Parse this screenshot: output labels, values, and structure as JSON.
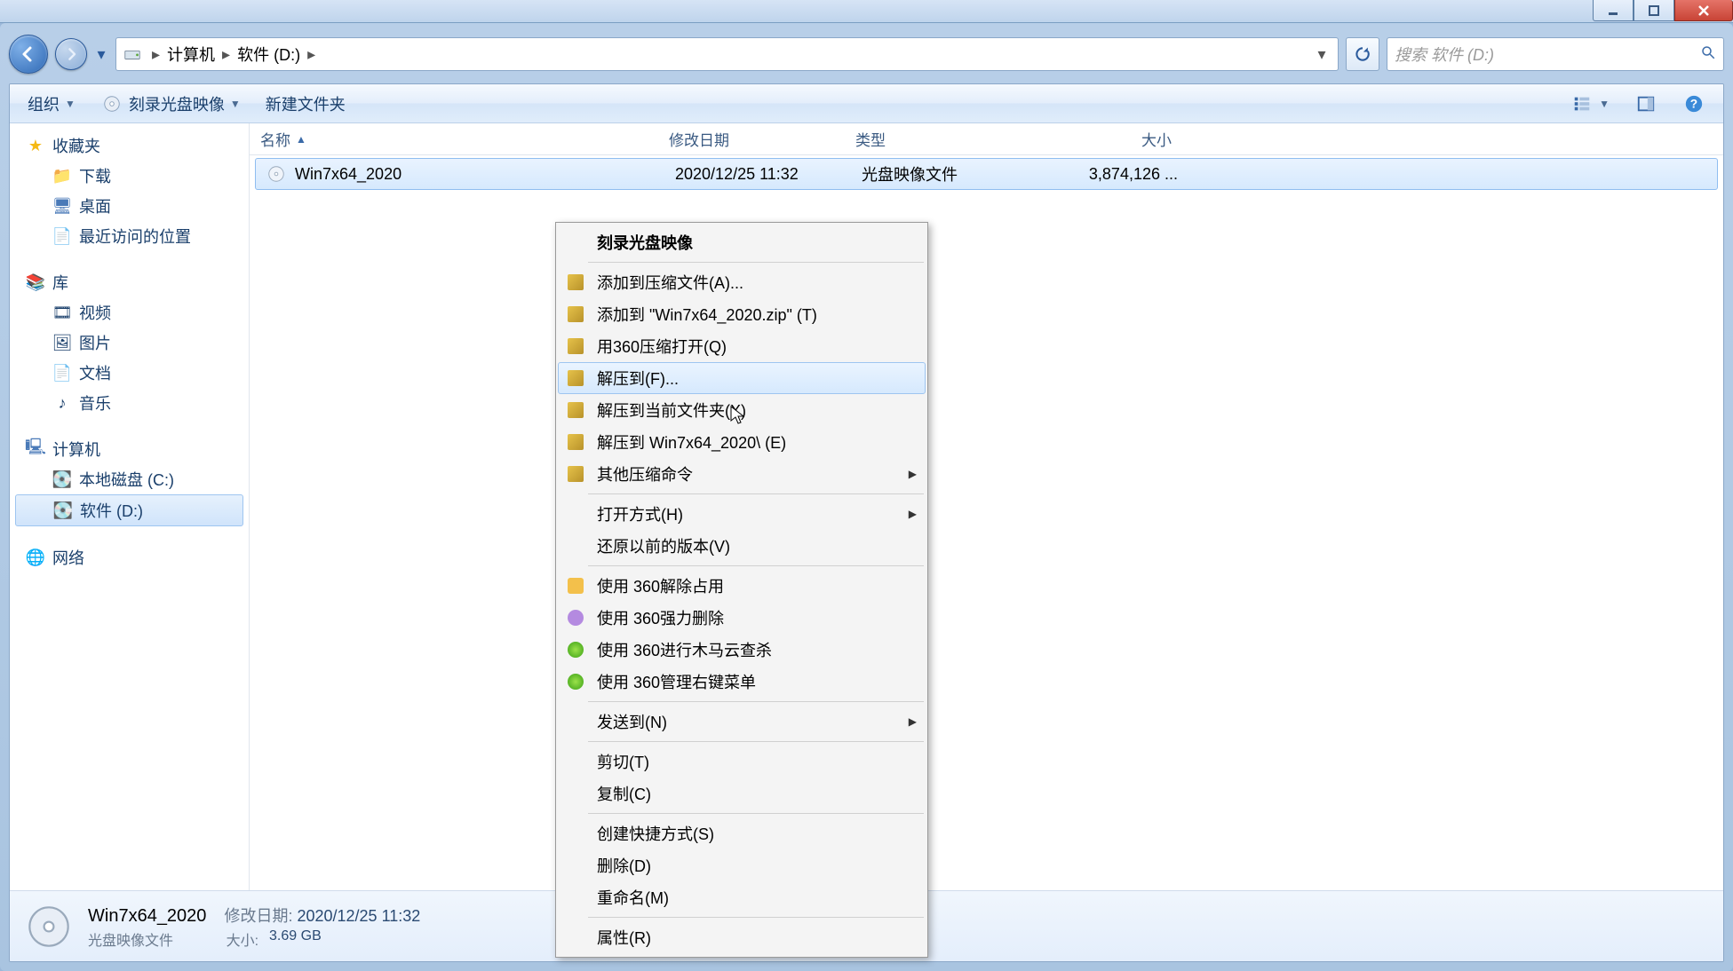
{
  "window": {
    "title": ""
  },
  "addressbar": {
    "crumbs": [
      "计算机",
      "软件 (D:)"
    ]
  },
  "search": {
    "placeholder": "搜索 软件 (D:)"
  },
  "toolbar": {
    "organize": "组织",
    "burn": "刻录光盘映像",
    "newfolder": "新建文件夹"
  },
  "sidebar": {
    "favorites": {
      "label": "收藏夹",
      "items": [
        "下载",
        "桌面",
        "最近访问的位置"
      ]
    },
    "libraries": {
      "label": "库",
      "items": [
        "视频",
        "图片",
        "文档",
        "音乐"
      ]
    },
    "computer": {
      "label": "计算机",
      "items": [
        "本地磁盘 (C:)",
        "软件 (D:)"
      ]
    },
    "network": {
      "label": "网络"
    }
  },
  "columns": {
    "name": "名称",
    "date": "修改日期",
    "type": "类型",
    "size": "大小"
  },
  "files": [
    {
      "name": "Win7x64_2020",
      "date": "2020/12/25 11:32",
      "type": "光盘映像文件",
      "size": "3,874,126 ..."
    }
  ],
  "context_menu": {
    "burn": "刻录光盘映像",
    "addarchive": "添加到压缩文件(A)...",
    "addzip": "添加到 \"Win7x64_2020.zip\" (T)",
    "open360": "用360压缩打开(Q)",
    "extractto": "解压到(F)...",
    "extracthere": "解压到当前文件夹(X)",
    "extractfolder": "解压到 Win7x64_2020\\ (E)",
    "othercompress": "其他压缩命令",
    "openwith": "打开方式(H)",
    "restore": "还原以前的版本(V)",
    "unlock360": "使用 360解除占用",
    "forcedel360": "使用 360强力删除",
    "scan360": "使用 360进行木马云查杀",
    "menu360": "使用 360管理右键菜单",
    "sendto": "发送到(N)",
    "cut": "剪切(T)",
    "copy": "复制(C)",
    "shortcut": "创建快捷方式(S)",
    "delete": "删除(D)",
    "rename": "重命名(M)",
    "properties": "属性(R)"
  },
  "details": {
    "name": "Win7x64_2020",
    "type": "光盘映像文件",
    "date_label": "修改日期:",
    "date": "2020/12/25 11:32",
    "size_label": "大小:",
    "size": "3.69 GB"
  }
}
